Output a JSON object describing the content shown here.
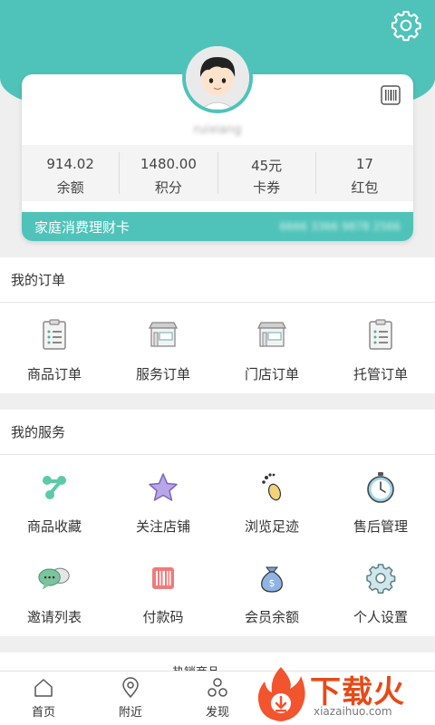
{
  "profile": {
    "username": "ruixiang",
    "card_title": "家庭消费理财卡",
    "card_number": "6666 3366 9878 2566",
    "stats": [
      {
        "value": "914.02",
        "label": "余额"
      },
      {
        "value": "1480.00",
        "label": "积分"
      },
      {
        "value": "45元",
        "label": "卡券"
      },
      {
        "value": "17",
        "label": "红包"
      }
    ]
  },
  "orders": {
    "title": "我的订单",
    "items": [
      {
        "label": "商品订单",
        "icon": "clipboard-list-icon"
      },
      {
        "label": "服务订单",
        "icon": "storefront-icon"
      },
      {
        "label": "门店订单",
        "icon": "storefront-icon"
      },
      {
        "label": "托管订单",
        "icon": "clipboard-list-icon"
      }
    ]
  },
  "services": {
    "title": "我的服务",
    "items": [
      {
        "label": "商品收藏",
        "icon": "share-nodes-icon"
      },
      {
        "label": "关注店铺",
        "icon": "star-icon"
      },
      {
        "label": "浏览足迹",
        "icon": "footprint-icon"
      },
      {
        "label": "售后管理",
        "icon": "stopwatch-icon"
      },
      {
        "label": "邀请列表",
        "icon": "chat-bubbles-icon"
      },
      {
        "label": "付款码",
        "icon": "barcode-icon"
      },
      {
        "label": "会员余额",
        "icon": "money-bag-icon"
      },
      {
        "label": "个人设置",
        "icon": "gear-icon"
      }
    ]
  },
  "peek_section": "热销商品",
  "tabbar": [
    {
      "label": "首页",
      "icon": "home-icon"
    },
    {
      "label": "附近",
      "icon": "location-pin-icon"
    },
    {
      "label": "发现",
      "icon": "discover-icon"
    }
  ],
  "watermark": {
    "title": "下载火",
    "sub": "xiazaihuo.com"
  },
  "colors": {
    "accent": "#4fc3b9",
    "background": "#efefef",
    "watermark": "#e64a19"
  }
}
